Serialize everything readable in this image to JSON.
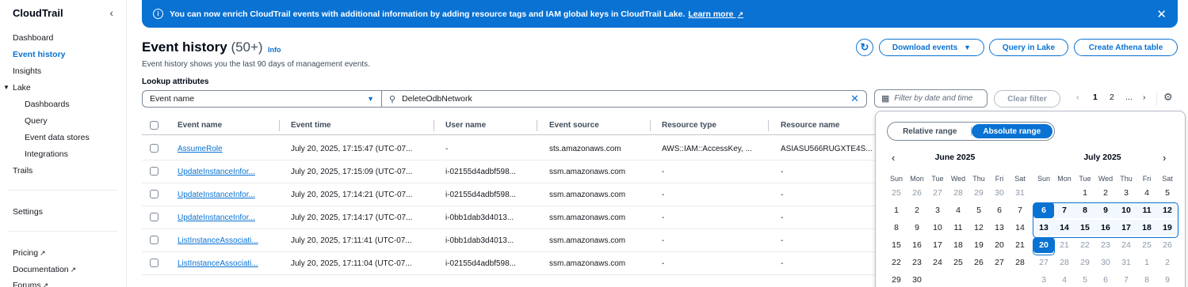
{
  "sidebar": {
    "title": "CloudTrail",
    "items": [
      {
        "label": "Dashboard"
      },
      {
        "label": "Event history"
      },
      {
        "label": "Insights"
      },
      {
        "label": "Lake"
      },
      {
        "label": "Dashboards"
      },
      {
        "label": "Query"
      },
      {
        "label": "Event data stores"
      },
      {
        "label": "Integrations"
      },
      {
        "label": "Trails"
      },
      {
        "label": "Settings"
      },
      {
        "label": "Pricing"
      },
      {
        "label": "Documentation"
      },
      {
        "label": "Forums"
      }
    ]
  },
  "banner": {
    "text": "You can now enrich CloudTrail events with additional information by adding resource tags and IAM global keys in CloudTrail Lake.",
    "link": "Learn more"
  },
  "header": {
    "title": "Event history",
    "count": "(50+)",
    "info": "Info",
    "description": "Event history shows you the last 90 days of management events.",
    "lookup_label": "Lookup attributes",
    "buttons": {
      "download": "Download events",
      "query_lake": "Query in Lake",
      "athena": "Create Athena table"
    }
  },
  "filter": {
    "attribute": "Event name",
    "value": "DeleteOdbNetwork",
    "date_placeholder": "Filter by date and time",
    "clear": "Clear filter",
    "pages": [
      "1",
      "2",
      "..."
    ]
  },
  "table": {
    "columns": [
      "Event name",
      "Event time",
      "User name",
      "Event source",
      "Resource type",
      "Resource name"
    ],
    "rows": [
      {
        "event_name": "AssumeRole",
        "event_time": "July 20, 2025, 17:15:47 (UTC-07...",
        "user_name": "-",
        "event_source": "sts.amazonaws.com",
        "resource_type": "AWS::IAM::AccessKey, ...",
        "resource_name": "ASIASU566RUGXTE4S..."
      },
      {
        "event_name": "UpdateInstanceInfor...",
        "event_time": "July 20, 2025, 17:15:09 (UTC-07...",
        "user_name": "i-02155d4adbf598...",
        "event_source": "ssm.amazonaws.com",
        "resource_type": "-",
        "resource_name": "-"
      },
      {
        "event_name": "UpdateInstanceInfor...",
        "event_time": "July 20, 2025, 17:14:21 (UTC-07...",
        "user_name": "i-02155d4adbf598...",
        "event_source": "ssm.amazonaws.com",
        "resource_type": "-",
        "resource_name": "-"
      },
      {
        "event_name": "UpdateInstanceInfor...",
        "event_time": "July 20, 2025, 17:14:17 (UTC-07...",
        "user_name": "i-0bb1dab3d4013...",
        "event_source": "ssm.amazonaws.com",
        "resource_type": "-",
        "resource_name": "-"
      },
      {
        "event_name": "ListInstanceAssociati...",
        "event_time": "July 20, 2025, 17:11:41 (UTC-07...",
        "user_name": "i-0bb1dab3d4013...",
        "event_source": "ssm.amazonaws.com",
        "resource_type": "-",
        "resource_name": "-"
      },
      {
        "event_name": "ListInstanceAssociati...",
        "event_time": "July 20, 2025, 17:11:04 (UTC-07...",
        "user_name": "i-02155d4adbf598...",
        "event_source": "ssm.amazonaws.com",
        "resource_type": "-",
        "resource_name": "-"
      }
    ]
  },
  "datepicker": {
    "modes": [
      "Relative range",
      "Absolute range"
    ],
    "active_mode": "Absolute range",
    "weekdays": [
      "Sun",
      "Mon",
      "Tue",
      "Wed",
      "Thu",
      "Fri",
      "Sat"
    ],
    "months": [
      {
        "title": "June 2025",
        "weeks": [
          [
            "25",
            "26",
            "27",
            "28",
            "29",
            "30",
            "31"
          ],
          [
            "1",
            "2",
            "3",
            "4",
            "5",
            "6",
            "7"
          ],
          [
            "8",
            "9",
            "10",
            "11",
            "12",
            "13",
            "14"
          ],
          [
            "15",
            "16",
            "17",
            "18",
            "19",
            "20",
            "21"
          ],
          [
            "22",
            "23",
            "24",
            "25",
            "26",
            "27",
            "28"
          ],
          [
            "29",
            "30",
            "",
            "",
            "",
            "",
            ""
          ]
        ]
      },
      {
        "title": "July 2025",
        "weeks": [
          [
            "",
            "",
            "1",
            "2",
            "3",
            "4",
            "5"
          ],
          [
            "6",
            "7",
            "8",
            "9",
            "10",
            "11",
            "12"
          ],
          [
            "13",
            "14",
            "15",
            "16",
            "17",
            "18",
            "19"
          ],
          [
            "20",
            "21",
            "22",
            "23",
            "24",
            "25",
            "26"
          ],
          [
            "27",
            "28",
            "29",
            "30",
            "31",
            "1",
            "2"
          ],
          [
            "3",
            "4",
            "5",
            "6",
            "7",
            "8",
            "9"
          ]
        ]
      }
    ],
    "range_start": "6",
    "range_end": "20"
  },
  "colors": {
    "accent": "#0972d3",
    "text": "#16191f",
    "muted": "#8d99a8"
  }
}
